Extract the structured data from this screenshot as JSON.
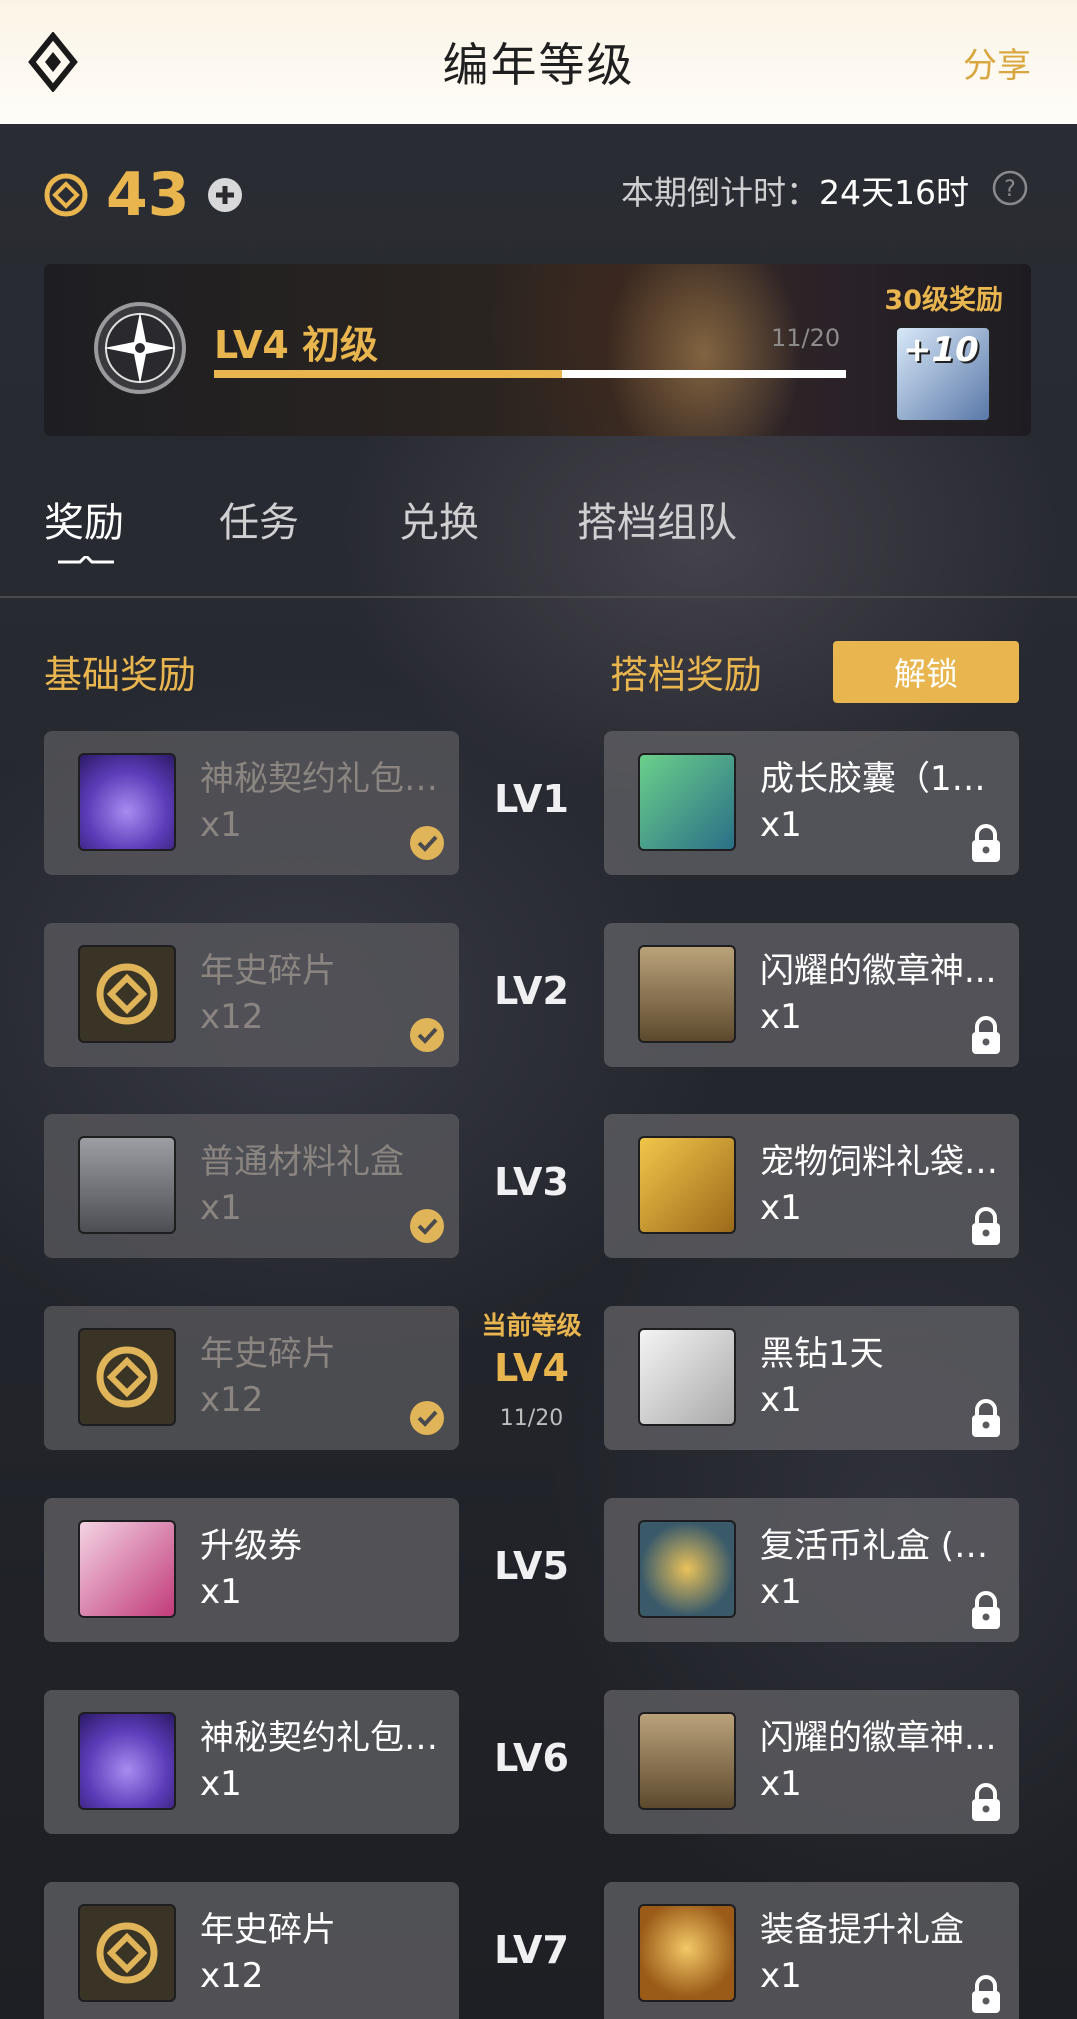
{
  "header": {
    "title": "编年等级",
    "share_label": "分享"
  },
  "stats": {
    "points": "43",
    "countdown_label": "本期倒计时：",
    "countdown_value": "24天16时"
  },
  "banner": {
    "level_name": "LV4 初级",
    "progress_text": "11/20",
    "progress_fraction": 0.55,
    "reward_label": "30级奖励",
    "reward_badge": "+10"
  },
  "tabs": [
    {
      "label": "奖励"
    },
    {
      "label": "任务"
    },
    {
      "label": "兑换"
    },
    {
      "label": "搭档组队"
    }
  ],
  "sections": {
    "basic_title": "基础奖励",
    "partner_title": "搭档奖励",
    "unlock_label": "解锁"
  },
  "current_level": {
    "tag": "当前等级",
    "progress": "11/20"
  },
  "rows": [
    {
      "level": "LV1",
      "basic": {
        "name": "神秘契约礼包 ...",
        "qty": "x1",
        "icon": "mystic-bag-icon"
      },
      "partner": {
        "name": "成长胶囊（10...",
        "qty": "x1",
        "icon": "exp-capsule-icon"
      }
    },
    {
      "level": "LV2",
      "basic": {
        "name": "年史碎片",
        "qty": "x12",
        "icon": "chronicle-shard-icon"
      },
      "partner": {
        "name": "闪耀的徽章神...",
        "qty": "x1",
        "icon": "badge-chest-icon"
      }
    },
    {
      "level": "LV3",
      "basic": {
        "name": "普通材料礼盒",
        "qty": "x1",
        "icon": "material-box-icon"
      },
      "partner": {
        "name": "宠物饲料礼袋 ...",
        "qty": "x1",
        "icon": "pet-feed-icon"
      }
    },
    {
      "level": "LV4",
      "basic": {
        "name": "年史碎片",
        "qty": "x12",
        "icon": "chronicle-shard-icon"
      },
      "partner": {
        "name": "黑钻1天",
        "qty": "x1",
        "icon": "black-diamond-icon"
      }
    },
    {
      "level": "LV5",
      "basic": {
        "name": "升级券",
        "qty": "x1",
        "icon": "level-ticket-icon"
      },
      "partner": {
        "name": "复活币礼盒 (1...",
        "qty": "x1",
        "icon": "revive-coin-icon"
      }
    },
    {
      "level": "LV6",
      "basic": {
        "name": "神秘契约礼包 ...",
        "qty": "x1",
        "icon": "mystic-bag-icon"
      },
      "partner": {
        "name": "闪耀的徽章神...",
        "qty": "x1",
        "icon": "badge-chest-icon"
      }
    },
    {
      "level": "LV7",
      "basic": {
        "name": "年史碎片",
        "qty": "x12",
        "icon": "chronicle-shard-icon"
      },
      "partner": {
        "name": "装备提升礼盒",
        "qty": "x1",
        "icon": "equip-box-icon"
      }
    }
  ],
  "colors": {
    "accent": "#e8b54f",
    "card": "#646468",
    "background": "#24262b"
  }
}
